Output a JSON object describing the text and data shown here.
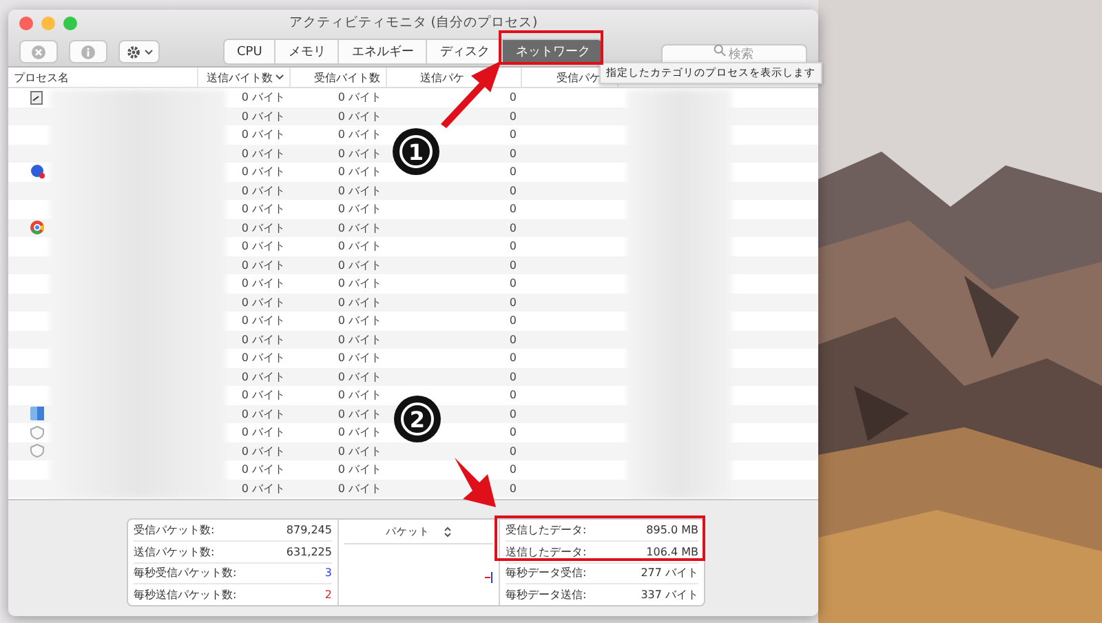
{
  "window": {
    "title": "アクティビティモニタ (自分のプロセス)"
  },
  "tabs": [
    {
      "label": "CPU",
      "selected": false
    },
    {
      "label": "メモリ",
      "selected": false
    },
    {
      "label": "エネルギー",
      "selected": false
    },
    {
      "label": "ディスク",
      "selected": false
    },
    {
      "label": "ネットワーク",
      "selected": true
    }
  ],
  "search": {
    "placeholder": "検索"
  },
  "tooltip": "指定したカテゴリのプロセスを表示します",
  "table": {
    "columns": [
      {
        "label": "プロセス名",
        "sorted": false
      },
      {
        "label": "送信バイト数",
        "sorted": true
      },
      {
        "label": "受信バイト数",
        "sorted": false
      },
      {
        "label": "送信パケ",
        "sorted": false
      },
      {
        "label": "受信パケ",
        "sorted": false
      }
    ],
    "rows": [
      {
        "kind": "document",
        "sent": "0 バイト",
        "received": "0 バイト",
        "packets": "0"
      },
      {
        "kind": "plain",
        "sent": "0 バイト",
        "received": "0 バイト",
        "packets": "0"
      },
      {
        "kind": "plain",
        "sent": "0 バイト",
        "received": "0 バイト",
        "packets": "0"
      },
      {
        "kind": "plain",
        "sent": "0 バイト",
        "received": "0 バイト",
        "packets": "0"
      },
      {
        "kind": "globe",
        "sent": "0 バイト",
        "received": "0 バイト",
        "packets": "0"
      },
      {
        "kind": "plain",
        "sent": "0 バイト",
        "received": "0 バイト",
        "packets": "0"
      },
      {
        "kind": "plain",
        "sent": "0 バイト",
        "received": "0 バイト",
        "packets": "0"
      },
      {
        "kind": "browser",
        "sent": "0 バイト",
        "received": "0 バイト",
        "packets": "0"
      },
      {
        "kind": "plain",
        "sent": "0 バイト",
        "received": "0 バイト",
        "packets": "0"
      },
      {
        "kind": "plain",
        "sent": "0 バイト",
        "received": "0 バイト",
        "packets": "0"
      },
      {
        "kind": "plain",
        "sent": "0 バイト",
        "received": "0 バイト",
        "packets": "0"
      },
      {
        "kind": "plain",
        "sent": "0 バイト",
        "received": "0 バイト",
        "packets": "0"
      },
      {
        "kind": "plain",
        "sent": "0 バイト",
        "received": "0 バイト",
        "packets": "0"
      },
      {
        "kind": "plain",
        "sent": "0 バイト",
        "received": "0 バイト",
        "packets": "0"
      },
      {
        "kind": "plain",
        "sent": "0 バイト",
        "received": "0 バイト",
        "packets": "0"
      },
      {
        "kind": "plain",
        "sent": "0 バイト",
        "received": "0 バイト",
        "packets": "0"
      },
      {
        "kind": "plain",
        "sent": "0 バイト",
        "received": "0 バイト",
        "packets": "0"
      },
      {
        "kind": "app",
        "sent": "0 バイト",
        "received": "0 バイト",
        "packets": "0"
      },
      {
        "kind": "shield",
        "sent": "0 バイト",
        "received": "0 バイト",
        "packets": "0"
      },
      {
        "kind": "shield",
        "sent": "0 バイト",
        "received": "0 バイト",
        "packets": "0"
      },
      {
        "kind": "plain",
        "sent": "0 バイト",
        "received": "0 バイト",
        "packets": "0"
      },
      {
        "kind": "plain",
        "sent": "0 バイト",
        "received": "0 バイト",
        "packets": "0"
      }
    ]
  },
  "summary": {
    "left": [
      {
        "label": "受信パケット数:",
        "value": "879,245"
      },
      {
        "label": "送信パケット数:",
        "value": "631,225"
      },
      {
        "label": "毎秒受信パケット数:",
        "value": "3",
        "color": "#2a3cf0"
      },
      {
        "label": "毎秒送信パケット数:",
        "value": "2",
        "color": "#e02020"
      }
    ],
    "graph_selector": "パケット",
    "right": [
      {
        "label": "受信したデータ:",
        "value": "895.0 MB"
      },
      {
        "label": "送信したデータ:",
        "value": "106.4 MB"
      },
      {
        "label": "毎秒データ受信:",
        "value": "277 バイト"
      },
      {
        "label": "毎秒データ送信:",
        "value": "337 バイト"
      }
    ]
  },
  "annotations": [
    {
      "label": "1"
    },
    {
      "label": "2"
    }
  ]
}
